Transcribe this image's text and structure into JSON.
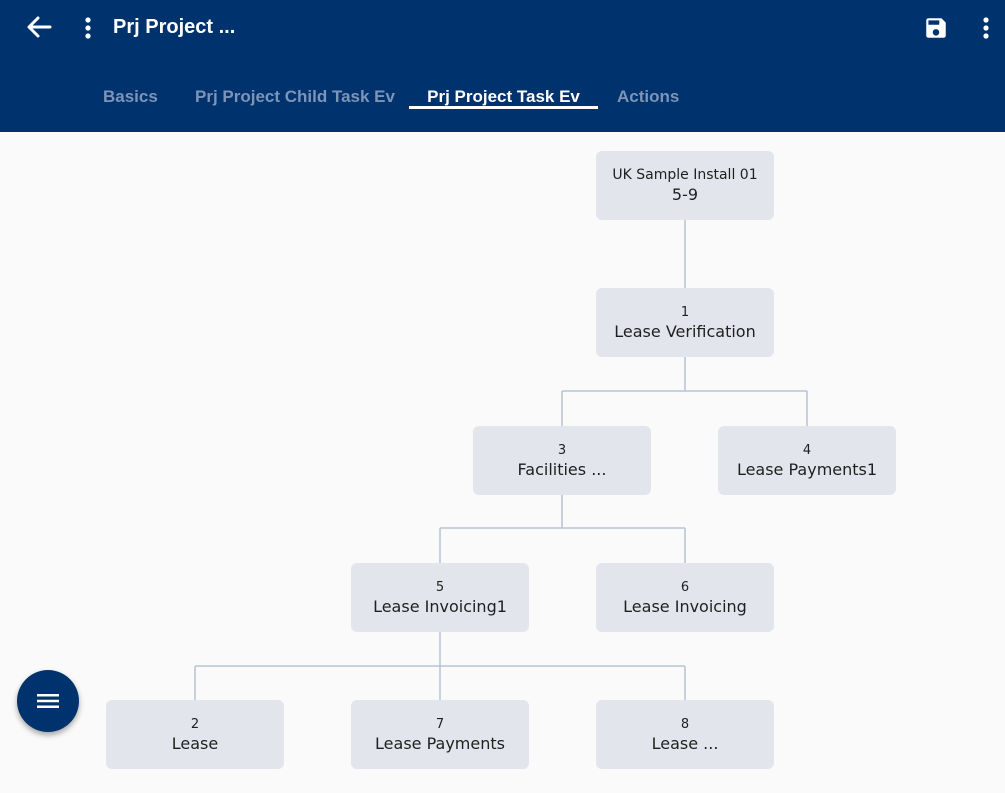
{
  "appbar": {
    "title": "Prj Project ...",
    "icons": {
      "back": "arrow-left-icon",
      "menu": "more-vertical-icon",
      "save": "save-icon",
      "overflow": "more-vertical-icon"
    }
  },
  "tabs": [
    {
      "label": "Basics",
      "active": false
    },
    {
      "label": "Prj Project Child Task Ev",
      "active": false
    },
    {
      "label": "Prj Project Task Ev",
      "active": true
    },
    {
      "label": "Actions",
      "active": false
    }
  ],
  "tree": {
    "root": {
      "num": "UK Sample Install 01",
      "label": "5-9"
    },
    "nodes": [
      {
        "num": "1",
        "label": "Lease Verification"
      },
      {
        "num": "3",
        "label": "Facilities ..."
      },
      {
        "num": "4",
        "label": "Lease Payments1"
      },
      {
        "num": "5",
        "label": "Lease Invoicing1"
      },
      {
        "num": "6",
        "label": "Lease Invoicing"
      },
      {
        "num": "2",
        "label": "Lease"
      },
      {
        "num": "7",
        "label": "Lease Payments"
      },
      {
        "num": "8",
        "label": "Lease ..."
      }
    ]
  },
  "fab": {
    "icon": "menu-icon"
  },
  "colors": {
    "appbar": "#00336e",
    "node": "#e2e6ec",
    "connector": "#b7c3d4",
    "tab_inactive": "#7c94b8",
    "background": "#fafafa"
  }
}
